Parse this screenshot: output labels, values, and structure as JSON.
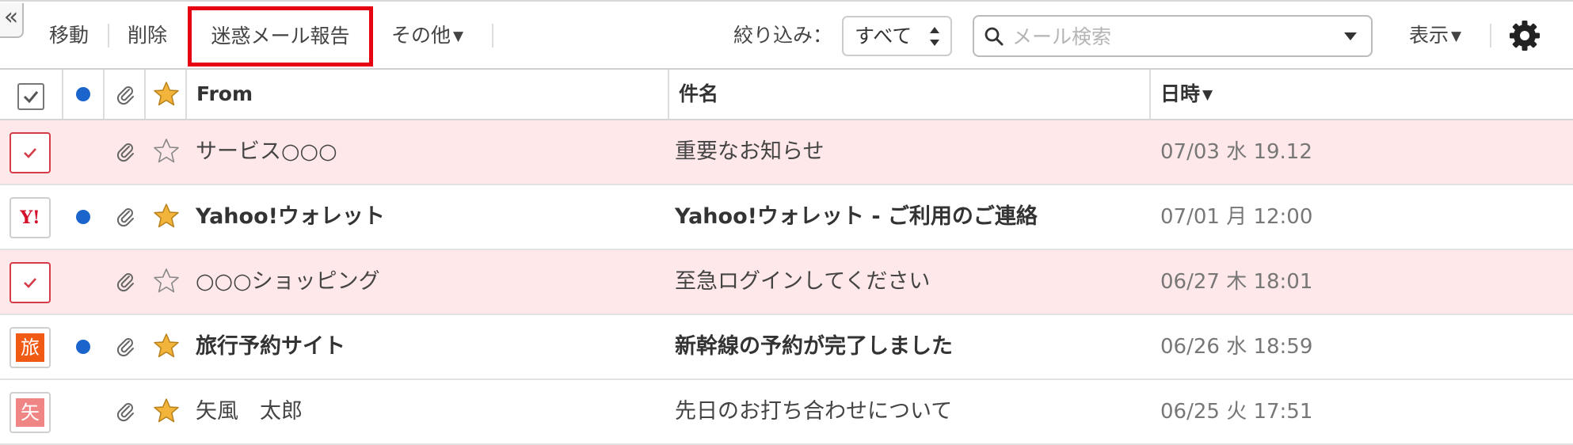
{
  "toolbar": {
    "collapse_glyph": "«",
    "move_label": "移動",
    "delete_label": "削除",
    "spam_label": "迷惑メール報告",
    "other_label": "その他",
    "filter_label": "絞り込み：",
    "filter_value": "すべて",
    "search_placeholder": "メール検索",
    "view_label": "表示"
  },
  "table": {
    "columns": {
      "from": "From",
      "subject": "件名",
      "date": "日時"
    },
    "rows": [
      {
        "selected": true,
        "avatar": "check",
        "unread": false,
        "starred": false,
        "from": "サービス○○○",
        "subject": "重要なお知らせ",
        "date": "07/03 水 19.12",
        "bold": false
      },
      {
        "selected": false,
        "avatar": "yahoo-logo",
        "avatar_text": "Y!",
        "unread": true,
        "starred": true,
        "from": "Yahoo!ウォレット",
        "subject": "Yahoo!ウォレット - ご利用のご連絡",
        "date": "07/01 月 12:00",
        "bold": true
      },
      {
        "selected": true,
        "avatar": "check",
        "unread": false,
        "starred": false,
        "from": "○○○ショッピング",
        "subject": "至急ログインしてください",
        "date": "06/27 木 18:01",
        "bold": false
      },
      {
        "selected": false,
        "avatar": "letter",
        "avatar_text": "旅",
        "avatar_color": "#f05a14",
        "unread": true,
        "starred": true,
        "from": "旅行予約サイト",
        "subject": "新幹線の予約が完了しました",
        "date": "06/26 水 18:59",
        "bold": true
      },
      {
        "selected": false,
        "avatar": "letter",
        "avatar_text": "矢",
        "avatar_color": "#f08585",
        "unread": false,
        "starred": true,
        "from": "矢風　太郎",
        "subject": "先日のお打ち合わせについて",
        "date": "06/25 火 17:51",
        "bold": false
      }
    ]
  },
  "colors": {
    "accent_red": "#e60012",
    "selected_row_bg": "#ffe8e9",
    "unread_dot": "#1a64cb",
    "star_fill": "#f2b43a"
  }
}
